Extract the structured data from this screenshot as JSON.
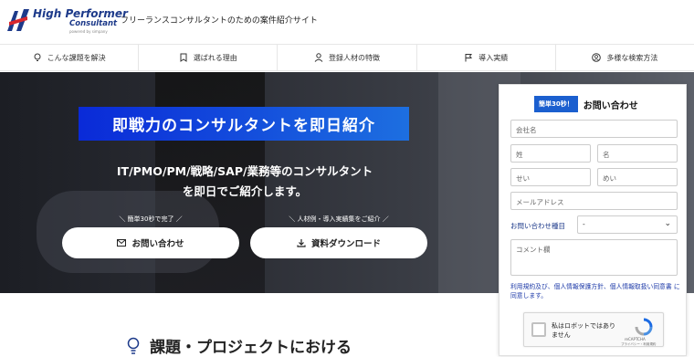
{
  "header": {
    "logo_line1": "High Performer",
    "logo_line2": "Consultant",
    "logo_line3": "powered by  simpany",
    "tagline": "フリーランスコンサルタントのための案件紹介サイト"
  },
  "nav": {
    "items": [
      {
        "label": "こんな課題を解決",
        "icon": "lightbulb-icon"
      },
      {
        "label": "選ばれる理由",
        "icon": "bookmark-icon"
      },
      {
        "label": "登録人材の特徴",
        "icon": "user-icon"
      },
      {
        "label": "導入実績",
        "icon": "flag-icon"
      },
      {
        "label": "多様な検索方法",
        "icon": "user-circle-icon"
      }
    ]
  },
  "hero": {
    "title": "即戦力のコンサルタントを即日紹介",
    "sub1": "IT/PMO/PM/戦略/SAP/業務等のコンサルタント",
    "sub2": "を即日でご紹介します。",
    "cta1_note": "＼ 簡単30秒で完了 ／",
    "cta1_label": "お問い合わせ",
    "cta2_note": "＼ 人材例・導入実績集をご紹介 ／",
    "cta2_label": "資料ダウンロード"
  },
  "section": {
    "title": "課題・プロジェクトにおける"
  },
  "form": {
    "badge": "簡単30秒！",
    "title": "お問い合わせ",
    "company_placeholder": "会社名",
    "sei_placeholder": "姓",
    "mei_placeholder": "名",
    "seik_placeholder": "せい",
    "meik_placeholder": "めい",
    "email_placeholder": "メールアドレス",
    "type_label": "お問い合わせ種目",
    "type_value": "-",
    "comment_placeholder": "コメント欄",
    "policy_text": "利用規約及び、個人情報保護方針、個人情報取扱い同意書 に同意します。",
    "recaptcha_text": "私はロボットではありません",
    "recaptcha_brand": "reCAPTCHA",
    "recaptcha_links": "プライバシー・利用規約"
  },
  "colors": {
    "brand": "#1d3a8a",
    "accent_blue": "#1b5fcf",
    "hero_banner_start": "#0a2ad8",
    "hero_banner_end": "#1d6fe0",
    "logo_red": "#d8262c"
  }
}
